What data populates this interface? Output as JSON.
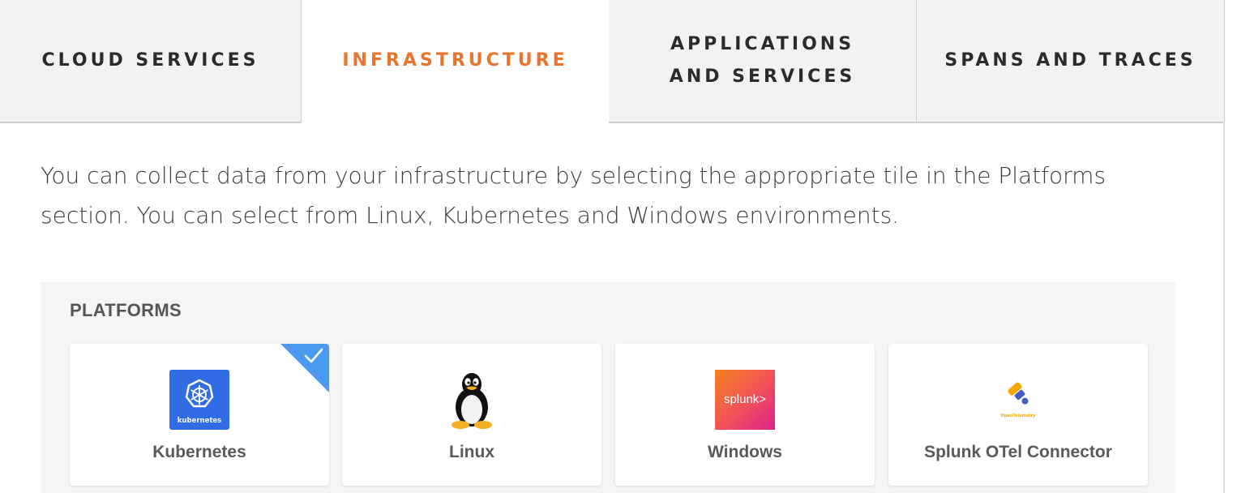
{
  "tabs": [
    {
      "label": "CLOUD SERVICES",
      "active": false
    },
    {
      "label": "INFRASTRUCTURE",
      "active": true
    },
    {
      "label": "APPLICATIONS AND SERVICES",
      "active": false
    },
    {
      "label": "SPANS AND TRACES",
      "active": false
    }
  ],
  "intro": "You can collect data from your infrastructure by selecting the appropriate tile in the Platforms section. You can select from Linux, Kubernetes and Windows environments.",
  "platforms": {
    "title": "PLATFORMS",
    "tiles": [
      {
        "label": "Kubernetes",
        "icon": "kubernetes-logo",
        "logo_text": "kubernetes",
        "selected": true
      },
      {
        "label": "Linux",
        "icon": "tux-penguin-logo",
        "selected": false
      },
      {
        "label": "Windows",
        "icon": "splunk-logo",
        "logo_text": "splunk>",
        "selected": false
      },
      {
        "label": "Splunk OTel Connector",
        "icon": "opentelemetry-logo",
        "logo_text": "OpenTelemetry",
        "selected": false
      }
    ]
  },
  "colors": {
    "accent": "#e8742e",
    "selected": "#4a9bf0",
    "kubernetes": "#326ce5"
  }
}
